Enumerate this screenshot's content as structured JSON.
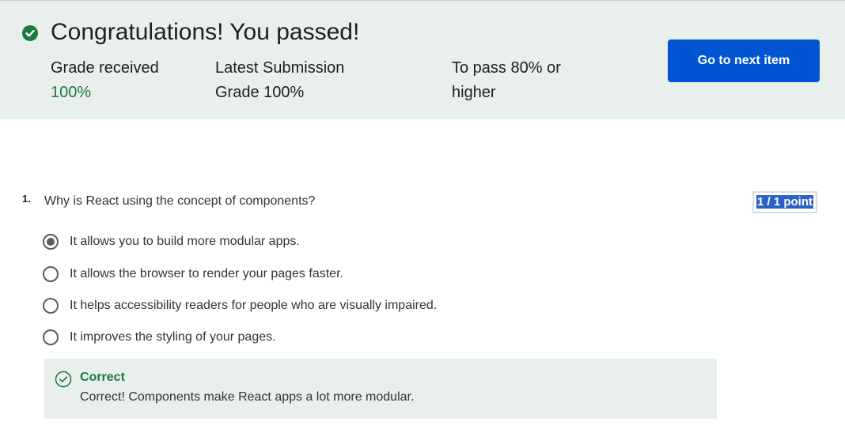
{
  "banner": {
    "title": "Congratulations! You passed!",
    "grade_received_label": "Grade received",
    "grade_received_value": "100%",
    "latest_submission_label": "Latest Submission Grade",
    "latest_submission_value": "100%",
    "to_pass_label": "To pass",
    "to_pass_value": "80% or higher",
    "check_icon": "check-circle-icon",
    "accent_color": "#1d7a3f"
  },
  "actions": {
    "next_item_label": "Go to next item",
    "button_color": "#0056d2"
  },
  "question": {
    "number": "1.",
    "text": "Why is React using the concept of components?",
    "points": "1 / 1 point",
    "options": [
      {
        "label": "It allows you to build more modular apps.",
        "selected": true
      },
      {
        "label": "It allows the browser to render your pages faster.",
        "selected": false
      },
      {
        "label": "It helps accessibility readers for people who are visually impaired.",
        "selected": false
      },
      {
        "label": "It improves the styling of your pages.",
        "selected": false
      }
    ],
    "feedback": {
      "title": "Correct",
      "text": "Correct! Components make React apps a lot more modular.",
      "icon": "check-circle-outline-icon"
    }
  }
}
